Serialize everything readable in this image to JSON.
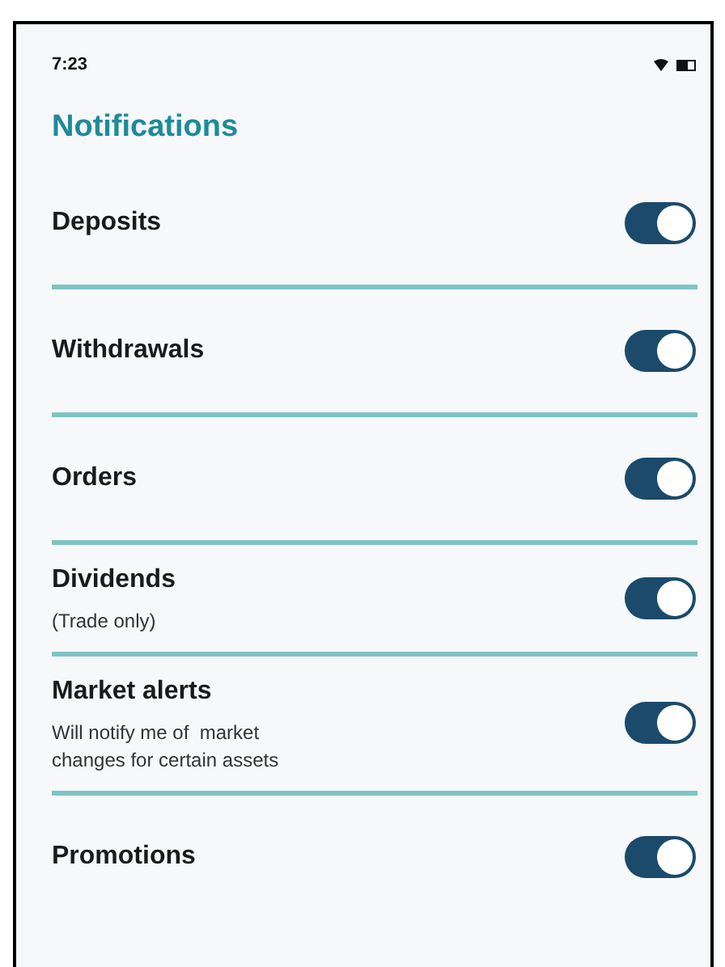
{
  "status_bar": {
    "time": "7:23"
  },
  "title": "Notifications",
  "settings": [
    {
      "label": "Deposits",
      "on": true
    },
    {
      "label": "Withdrawals",
      "on": true
    },
    {
      "label": "Orders",
      "on": true
    },
    {
      "label": "Dividends",
      "description": "(Trade only)",
      "on": true
    },
    {
      "label": "Market alerts",
      "description": "Will notify me of  market changes for certain assets",
      "on": true
    },
    {
      "label": "Promotions",
      "on": true
    }
  ]
}
